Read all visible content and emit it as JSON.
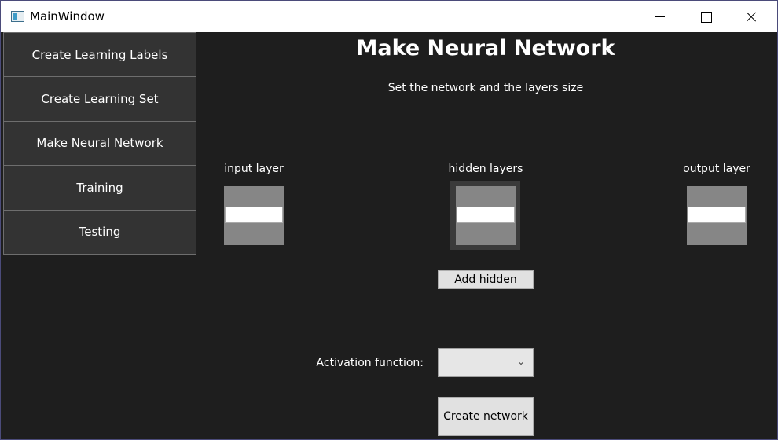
{
  "window": {
    "title": "MainWindow",
    "icons": {
      "app": "app-window-icon",
      "minimize": "minimize-icon",
      "maximize": "maximize-icon",
      "close": "close-icon"
    }
  },
  "nav": {
    "items": [
      {
        "label": "Create Learning Labels"
      },
      {
        "label": "Create Learning Set"
      },
      {
        "label": "Make Neural Network"
      },
      {
        "label": "Training"
      },
      {
        "label": "Testing"
      }
    ]
  },
  "main": {
    "title": "Make Neural Network",
    "subtitle": "Set the network and the layers size",
    "layers": {
      "input_label": "input layer",
      "hidden_label": "hidden layers",
      "output_label": "output layer",
      "input_value": "",
      "hidden_value": "",
      "output_value": ""
    },
    "add_hidden_label": "Add hidden",
    "activation": {
      "label": "Activation function:",
      "selected": "",
      "chevron_icon": "chevron-down-icon"
    },
    "create_label": "Create network"
  },
  "colors": {
    "background": "#1e1e1e",
    "nav_item": "#333333",
    "nav_border": "#6e6e6e",
    "spinbox": "#868686",
    "button": "#e1e1e1",
    "window_border": "#4b4b7a"
  }
}
